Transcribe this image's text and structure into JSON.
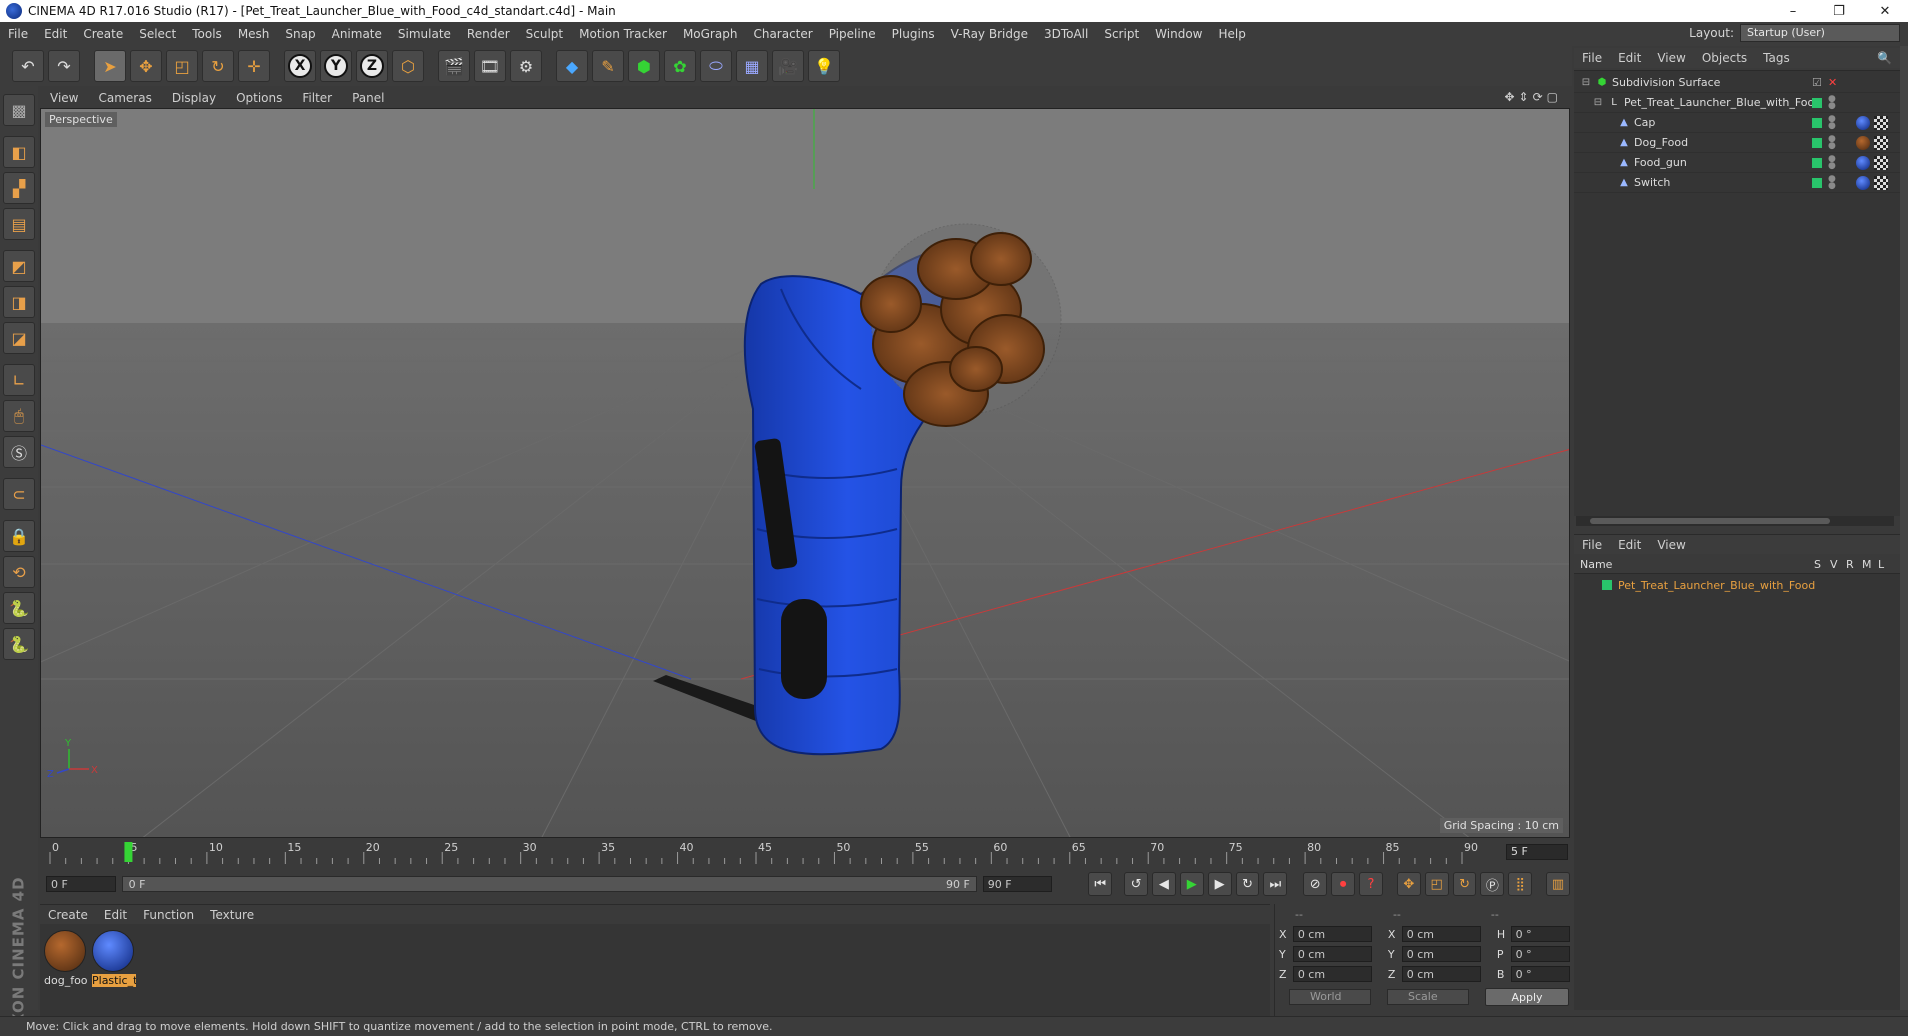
{
  "window": {
    "title": "CINEMA 4D R17.016 Studio (R17) - [Pet_Treat_Launcher_Blue_with_Food_c4d_standart.c4d] - Main",
    "minimize": "–",
    "restore": "❐",
    "close": "✕"
  },
  "menubar": {
    "items": [
      "File",
      "Edit",
      "Create",
      "Select",
      "Tools",
      "Mesh",
      "Snap",
      "Animate",
      "Simulate",
      "Render",
      "Sculpt",
      "Motion Tracker",
      "MoGraph",
      "Character",
      "Pipeline",
      "Plugins",
      "V-Ray Bridge",
      "3DToAll",
      "Script",
      "Window",
      "Help"
    ],
    "layout_label": "Layout:",
    "layout_value": "Startup (User)"
  },
  "toolbar": {
    "axis_x": "X",
    "axis_y": "Y",
    "axis_z": "Z"
  },
  "viewport": {
    "menu": [
      "View",
      "Cameras",
      "Display",
      "Options",
      "Filter",
      "Panel"
    ],
    "label": "Perspective",
    "grid_spacing": "Grid Spacing : 10 cm",
    "axis_y": "Y",
    "axis_x": "X",
    "axis_z": "Z"
  },
  "timeline": {
    "ticks": [
      "0",
      "5",
      "10",
      "15",
      "20",
      "25",
      "30",
      "35",
      "40",
      "45",
      "50",
      "55",
      "60",
      "65",
      "70",
      "75",
      "80",
      "85",
      "90"
    ],
    "current_frame": "5 F",
    "current_value": 5,
    "max_value": 90
  },
  "transport": {
    "start_field": "0 F",
    "range_start": "0 F",
    "range_end": "90 F",
    "end_field": "90 F"
  },
  "materials": {
    "menu": [
      "Create",
      "Edit",
      "Function",
      "Texture"
    ],
    "items": [
      {
        "label": "dog_foo",
        "color": "#6b3b1c"
      },
      {
        "label": "Plastic_t",
        "color": "#1a3fb5"
      }
    ]
  },
  "coordinates": {
    "header": [
      "--",
      "--",
      "--"
    ],
    "rows": [
      {
        "l1": "X",
        "v1": "0 cm",
        "l2": "X",
        "v2": "0 cm",
        "l3": "H",
        "v3": "0 °"
      },
      {
        "l1": "Y",
        "v1": "0 cm",
        "l2": "Y",
        "v2": "0 cm",
        "l3": "P",
        "v3": "0 °"
      },
      {
        "l1": "Z",
        "v1": "0 cm",
        "l2": "Z",
        "v2": "0 cm",
        "l3": "B",
        "v3": "0 °"
      }
    ],
    "mode": "World",
    "scale": "Scale",
    "apply": "Apply"
  },
  "objects": {
    "menu": [
      "File",
      "Edit",
      "View",
      "Objects",
      "Tags"
    ],
    "rows": [
      {
        "name": "Subdivision Surface",
        "indent": 0
      },
      {
        "name": "Pet_Treat_Launcher_Blue_with_Food",
        "indent": 1
      },
      {
        "name": "Cap",
        "indent": 2
      },
      {
        "name": "Dog_Food",
        "indent": 2
      },
      {
        "name": "Food_gun",
        "indent": 2
      },
      {
        "name": "Switch",
        "indent": 2
      }
    ]
  },
  "layers": {
    "menu": [
      "File",
      "Edit",
      "View"
    ],
    "col_name": "Name",
    "cols": [
      "S",
      "V",
      "R",
      "M",
      "L"
    ],
    "row": "Pet_Treat_Launcher_Blue_with_Food"
  },
  "statusbar": {
    "text": "Move: Click and drag to move elements. Hold down SHIFT to quantize movement / add to the selection in point mode, CTRL to remove."
  },
  "colors": {
    "accent_orange": "#e8a040",
    "layer_green": "#29c46b",
    "launcher_blue": "#1f4fe0",
    "food_brown": "#7a4520"
  }
}
